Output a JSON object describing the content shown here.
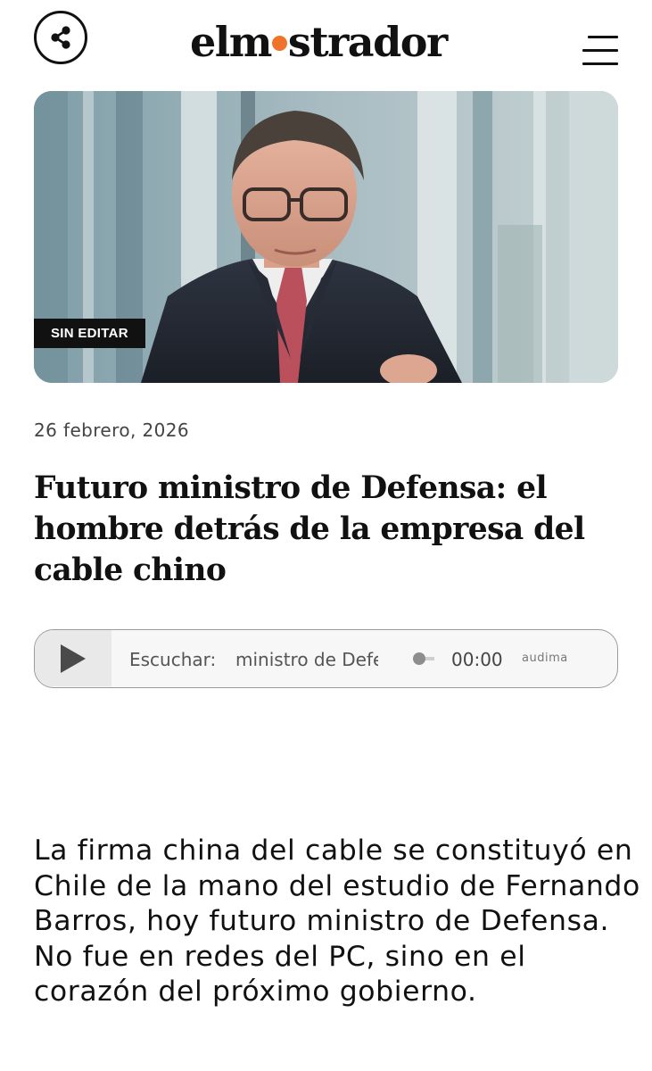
{
  "header": {
    "logo_left": "elm",
    "logo_right": "strador",
    "logo_dot_color": "#f0732a",
    "share_icon": "share-icon",
    "menu_icon": "hamburger-menu-icon"
  },
  "article": {
    "badge": "SIN EDITAR",
    "date": "26 febrero, 2026",
    "headline": "Futuro ministro de Defensa: el hombre detrás de la empresa del cable chino",
    "summary": "La firma china del cable se constituyó en Chile de la mano del estudio de Fernando Barros, hoy futuro ministro de Defensa. No fue en redes del PC, sino en el corazón del próximo gobierno."
  },
  "player": {
    "listen_label": "Escuchar:",
    "track_title": "ministro de Defensa",
    "time": "00:00",
    "brand": "audima",
    "progress": 0
  }
}
